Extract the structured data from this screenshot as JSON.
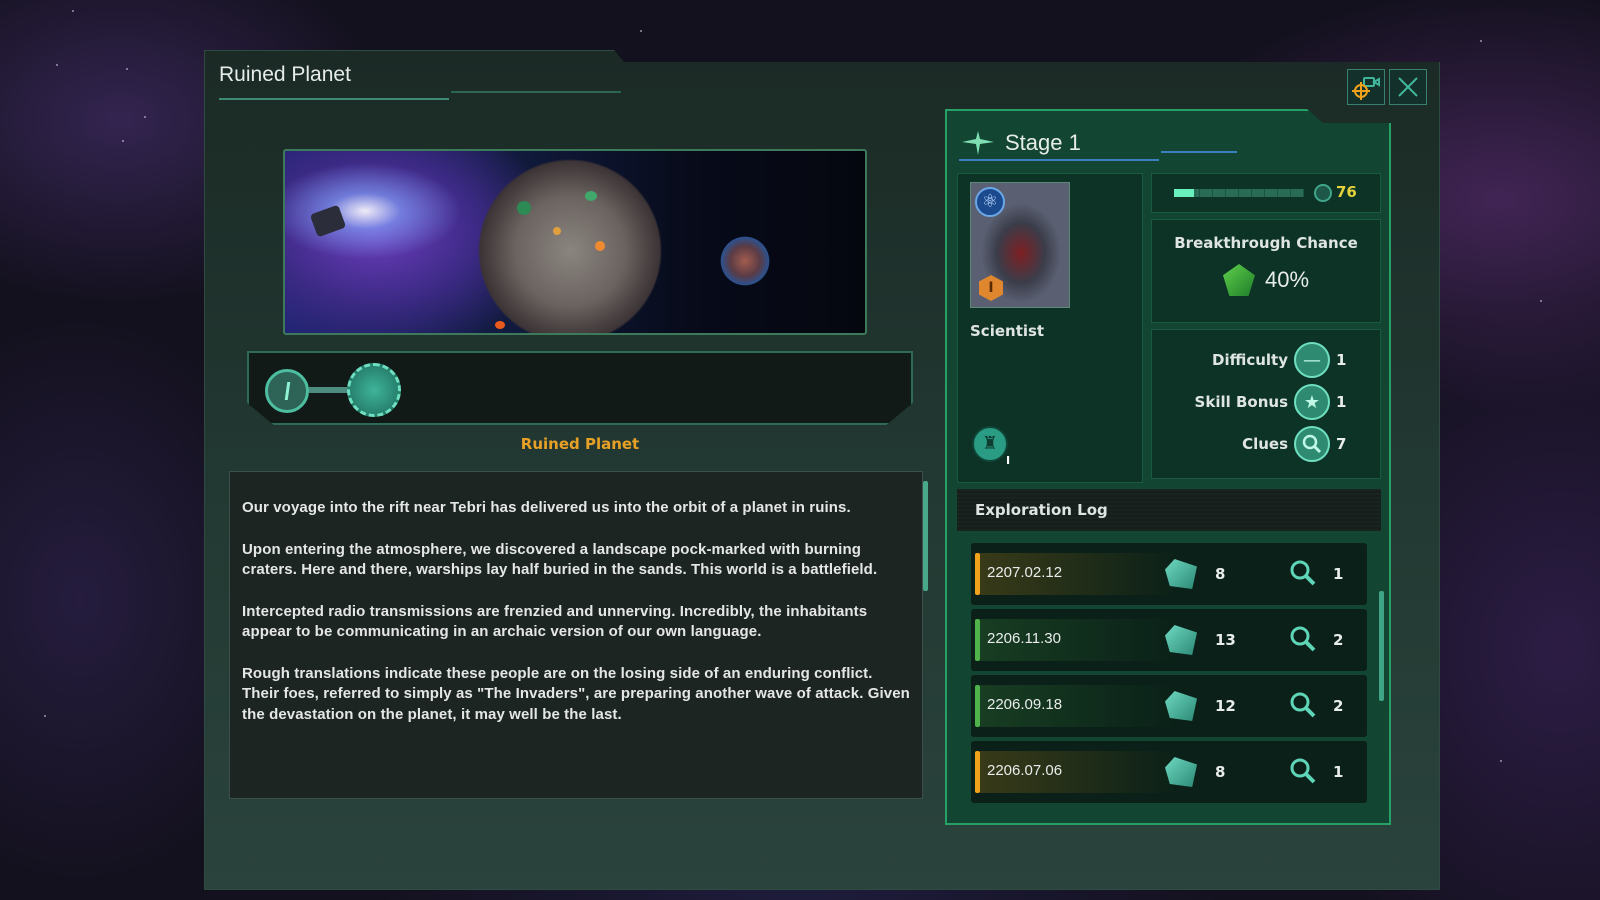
{
  "window": {
    "title": "Ruined Planet",
    "locate_button_icon": "camera-target-icon",
    "close_button_icon": "close-icon"
  },
  "project": {
    "name": "Ruined Planet",
    "tree_nodes": [
      {
        "label": "I",
        "state": "completed"
      },
      {
        "label": "",
        "state": "current"
      }
    ],
    "description": [
      "Our voyage into the rift near Tebri has delivered us into the orbit of a planet in ruins.",
      "Upon entering the atmosphere, we discovered a landscape pock-marked with burning craters. Here and there, warships lay half buried in the sands. This world is a battlefield.",
      "Intercepted radio transmissions are frenzied and unnerving. Incredibly, the inhabitants appear to be communicating in an archaic version of our own language.",
      "Rough translations indicate these people are on the losing side of an enduring conflict. Their foes, referred to simply as \"The Invaders\", are preparing another wave of attack. Given the devastation on the planet, it may well be the last."
    ]
  },
  "stage": {
    "title": "Stage 1",
    "progress_fraction": 0.15,
    "days_remaining": "76",
    "leader": {
      "class": "Scientist",
      "level": "I",
      "trait_rank": "I"
    },
    "breakthrough": {
      "label": "Breakthrough Chance",
      "value": "40%"
    },
    "stats": [
      {
        "label": "Difficulty",
        "icon": "difficulty-icon",
        "value": "1"
      },
      {
        "label": "Skill Bonus",
        "icon": "star-icon",
        "value": "1"
      },
      {
        "label": "Clues",
        "icon": "magnifier-icon",
        "value": "7"
      }
    ]
  },
  "log": {
    "title": "Exploration Log",
    "entries": [
      {
        "date": "2207.02.12",
        "points": "8",
        "clues": "1",
        "color": "#f0a21a"
      },
      {
        "date": "2206.11.30",
        "points": "13",
        "clues": "2",
        "color": "#4fb24a"
      },
      {
        "date": "2206.09.18",
        "points": "12",
        "clues": "2",
        "color": "#4fb24a"
      },
      {
        "date": "2206.07.06",
        "points": "8",
        "clues": "1",
        "color": "#f0a21a"
      }
    ]
  }
}
